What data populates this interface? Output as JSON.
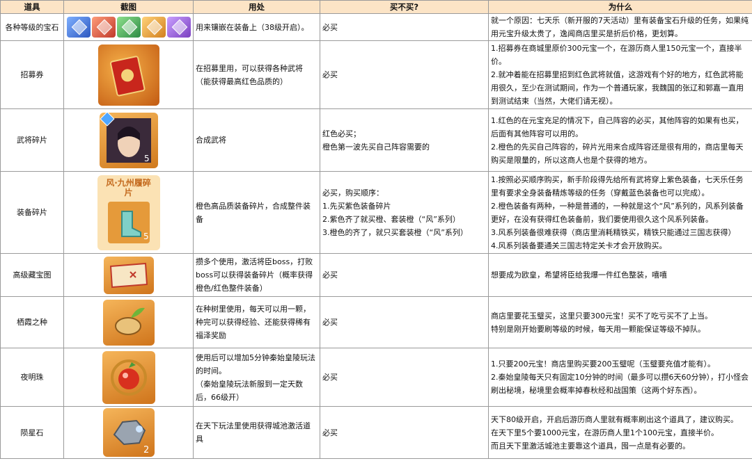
{
  "headers": {
    "item": "道具",
    "pic": "截图",
    "use": "用处",
    "buy": "买不买?",
    "why": "为什么"
  },
  "colors": {
    "header_bg": "#fce4c6",
    "grid": "#9a9a9a",
    "gem_colors": [
      "#3b6fd6",
      "#d84a3a",
      "#3aa05a",
      "#e0932c",
      "#8a4fc8"
    ]
  },
  "rows": [
    {
      "name": "各种等级的宝石",
      "icon": "gem-set-icon",
      "use": [
        "用来镶嵌在装备上（38级开启）。"
      ],
      "buy": [
        "必买"
      ],
      "why": [
        "就一个原因：七天乐（新开服的7天活动）里有装备宝石升级的任务，如果纯用元宝升级太贵了，逸闻商店里买是折后价格，更划算。"
      ]
    },
    {
      "name": "招募券",
      "icon": "recruit-ticket-icon",
      "use": [
        "在招募里用，可以获得各种武将（能获得最高红色品质的）"
      ],
      "buy": [
        "必买"
      ],
      "why": [
        "1.招募券在商城里原价300元宝一个，在游历商人里150元宝一个，直接半价。",
        "2.就冲着能在招募里招到红色武将就值，这游戏有个好的地方，红色武将能用很久，至少在测试期间，作为一个普通玩家，我魏国的张辽和郭嘉一直用到测试结束（当然，大佬们请无视）。"
      ]
    },
    {
      "name": "武将碎片",
      "icon": "general-fragment-icon",
      "badge": "5",
      "use": [
        "合成武将"
      ],
      "buy": [
        "红色必买；",
        "橙色第一波先买自己阵容需要的"
      ],
      "why": [
        "1.红色的在元宝充足的情况下，自己阵容的必买，其他阵容的如果有也买，后面有其他阵容可以用的。",
        "2.橙色的先买自己阵容的，碎片光用来合成阵容还是很有用的，商店里每天购买是限量的，所以这商人也是个获得的地方。"
      ]
    },
    {
      "name": "装备碎片",
      "icon": "equipment-fragment-icon",
      "item_caption": "风·九州履碎片",
      "badge": "5",
      "use": [
        "橙色高品质装备碎片，合成整件装备"
      ],
      "buy": [
        "必买，购买顺序：",
        "1.先买紫色装备碎片",
        "2.紫色齐了就买橙、套装橙（“风”系列）",
        "3.橙色的齐了，就只买套装橙（“风”系列）"
      ],
      "why": [
        "1.按照必买顺序购买，新手阶段得先给所有武将穿上紫色装备，七天乐任务里有要求全身装备精炼等级的任务（穿戴蓝色装备也可以完成）。",
        "2.橙色装备有两种，一种是普通的，一种就是这个“风”系列的，风系列装备更好，在没有获得红色装备前，我们要使用很久这个风系列装备。",
        "3.风系列装备很难获得（商店里消耗精铁买，精铁只能通过三国志获得）",
        "4.风系列装备要通关三国志特定关卡才会开放购买。"
      ]
    },
    {
      "name": "高级藏宝图",
      "icon": "treasure-map-icon",
      "use": [
        "攒多个使用，激活将臣boss，打败boss可以获得装备碎片（概率获得橙色/红色整件装备）"
      ],
      "buy": [
        "必买"
      ],
      "why": [
        "想要成为欧皇，希望将臣给我爆一件红色整装，嘻嘻"
      ]
    },
    {
      "name": "栖霞之种",
      "icon": "seed-icon",
      "use": [
        "在种树里使用，每天可以用一颗，种完可以获得经验、还能获得稀有福泽奖励"
      ],
      "buy": [
        "必买"
      ],
      "why": [
        "商店里要花玉璧买，这里只要300元宝！买不了吃亏买不了上当。",
        "特别是刚开始要刷等级的时候，每天用一颗能保证等级不掉队。"
      ]
    },
    {
      "name": "夜明珠",
      "icon": "night-pearl-icon",
      "use": [
        "使用后可以增加5分钟秦始皇陵玩法的时间。",
        "（秦始皇陵玩法新服到一定天数后，66级开）"
      ],
      "buy": [
        "必买"
      ],
      "why": [
        "1.只要200元宝！商店里购买要200玉璧呢（玉璧要充值才能有）。",
        "2.秦始皇陵每天只有固定10分钟的时间（最多可以攒6天60分钟），打小怪会刷出秘境，秘境里会概率掉春秋经和战国策（这两个好东西）。"
      ]
    },
    {
      "name": "陨星石",
      "icon": "meteor-stone-icon",
      "badge": "2",
      "use": [
        "在天下玩法里使用获得城池激活道具"
      ],
      "buy": [
        "必买"
      ],
      "why": [
        "天下80级开启，开启后游历商人里就有概率刷出这个道具了，建议购买。",
        "在天下里5个要1000元宝，在游历商人里1个100元宝，直接半价。",
        "而且天下里激活城池主要靠这个道具，囤一点是有必要的。"
      ]
    }
  ]
}
